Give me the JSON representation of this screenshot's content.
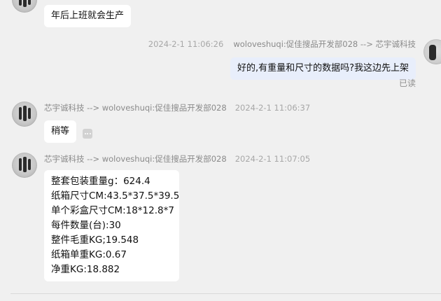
{
  "messages": {
    "m1": {
      "text": "年后上班就会生产"
    },
    "m2": {
      "timestamp": "2024-2-1 11:06:26",
      "sender": "woloveshuqi:促佳搜品开发部028 --> 芯宇诚科技",
      "text": "好的,有重量和尺寸的数据吗?我这边先上架",
      "status": "已读"
    },
    "m3": {
      "sender": "芯宇诚科技 --> woloveshuqi:促佳搜品开发部028",
      "timestamp": "2024-2-1 11:06:37",
      "text": "稍等"
    },
    "m4": {
      "sender": "芯宇诚科技 --> woloveshuqi:促佳搜品开发部028",
      "timestamp": "2024-2-1 11:07:05",
      "lines": [
        "整套包装重量g：624.4",
        "纸箱尺寸CM:43.5*37.5*39.5",
        "单个彩盒尺寸CM:18*12.8*7",
        "每件数量(台):30",
        "整件毛重KG;19.548",
        "纸箱单重KG:0.67",
        "净重KG:18.882"
      ]
    }
  },
  "colors": {
    "background": "#f0f0f0",
    "bubble_incoming": "#ffffff",
    "bubble_outgoing": "#e8eefb",
    "meta_text": "#8a8a8a"
  }
}
